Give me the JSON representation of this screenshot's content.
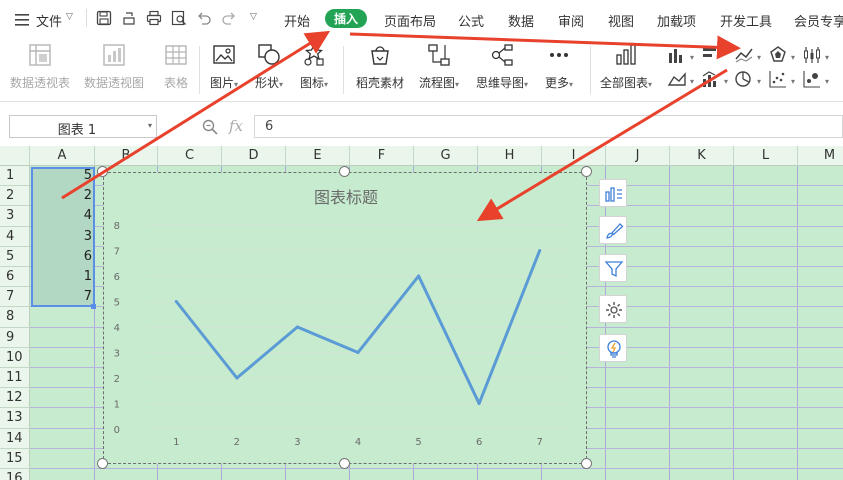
{
  "menu": {
    "file": "文件",
    "tabs": [
      "开始",
      "插入",
      "页面布局",
      "公式",
      "数据",
      "审阅",
      "视图",
      "加载项",
      "开发工具",
      "会员专享"
    ],
    "active_tab": "插入"
  },
  "ribbon": {
    "pivot_table": "数据透视表",
    "pivot_chart": "数据透视图",
    "table": "表格",
    "picture": "图片",
    "shape": "形状",
    "icon": "图标",
    "material": "稻壳素材",
    "flowchart": "流程图",
    "mindmap": "思维导图",
    "more": "更多",
    "all_charts": "全部图表"
  },
  "formula_bar": {
    "name_box": "图表 1",
    "fx": "fx",
    "value": "6"
  },
  "sheet": {
    "columns": [
      "A",
      "B",
      "C",
      "D",
      "E",
      "F",
      "G",
      "H",
      "I",
      "J",
      "K",
      "L",
      "M"
    ],
    "rows": [
      "1",
      "2",
      "3",
      "4",
      "5",
      "6",
      "7",
      "8",
      "9",
      "10",
      "11",
      "12",
      "13",
      "14",
      "15",
      "16"
    ],
    "col_a_values": [
      "5",
      "2",
      "4",
      "3",
      "6",
      "1",
      "7"
    ]
  },
  "chart_data": {
    "type": "line",
    "title": "图表标题",
    "x": [
      "1",
      "2",
      "3",
      "4",
      "5",
      "6",
      "7"
    ],
    "values": [
      5,
      2,
      4,
      3,
      6,
      1,
      7
    ],
    "ylim": [
      0,
      8
    ],
    "yticks": [
      "0",
      "1",
      "2",
      "3",
      "4",
      "5",
      "6",
      "7",
      "8"
    ],
    "line_color": "#5b9bd5",
    "grid": true
  },
  "colors": {
    "accent": "#23a455",
    "sheet_bg": "#c7ebcf",
    "arrow": "#e8412c"
  }
}
